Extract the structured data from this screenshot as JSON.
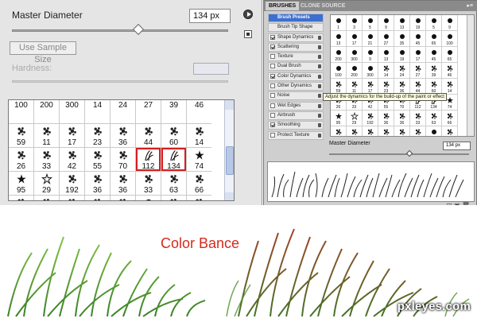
{
  "left_panel": {
    "master_diameter_label": "Master Diameter",
    "diameter_value": "134 px",
    "diameter_slider_value": 0.6,
    "use_sample_size_label": "Use Sample Size",
    "hardness_label": "Hardness:",
    "brush_grid": [
      {
        "n": "100",
        "icon": "none"
      },
      {
        "n": "200",
        "icon": "none"
      },
      {
        "n": "300",
        "icon": "none"
      },
      {
        "n": "14",
        "icon": "none"
      },
      {
        "n": "24",
        "icon": "none"
      },
      {
        "n": "27",
        "icon": "none"
      },
      {
        "n": "39",
        "icon": "none"
      },
      {
        "n": "46",
        "icon": "none"
      },
      {
        "n": "59",
        "icon": "spatter"
      },
      {
        "n": "11",
        "icon": "spatter"
      },
      {
        "n": "17",
        "icon": "spatter"
      },
      {
        "n": "23",
        "icon": "spatter"
      },
      {
        "n": "36",
        "icon": "spatter"
      },
      {
        "n": "44",
        "icon": "spatter"
      },
      {
        "n": "60",
        "icon": "spatter"
      },
      {
        "n": "14",
        "icon": "spatter"
      },
      {
        "n": "26",
        "icon": "spatter"
      },
      {
        "n": "33",
        "icon": "spatter"
      },
      {
        "n": "42",
        "icon": "spatter"
      },
      {
        "n": "55",
        "icon": "spatter"
      },
      {
        "n": "70",
        "icon": "spatter"
      },
      {
        "n": "112",
        "icon": "grass"
      },
      {
        "n": "134",
        "icon": "grass"
      },
      {
        "n": "74",
        "icon": "leaf"
      },
      {
        "n": "95",
        "icon": "leaf"
      },
      {
        "n": "29",
        "icon": "star"
      },
      {
        "n": "192",
        "icon": "spatter"
      },
      {
        "n": "36",
        "icon": "spatter"
      },
      {
        "n": "36",
        "icon": "spatter"
      },
      {
        "n": "33",
        "icon": "spatter"
      },
      {
        "n": "63",
        "icon": "spatter"
      },
      {
        "n": "66",
        "icon": "spatter"
      },
      {
        "n": "",
        "icon": "spatter"
      },
      {
        "n": "",
        "icon": "spatter"
      },
      {
        "n": "",
        "icon": "spatter"
      },
      {
        "n": "",
        "icon": "spatter"
      },
      {
        "n": "",
        "icon": "spatter"
      },
      {
        "n": "",
        "icon": "dot"
      },
      {
        "n": "",
        "icon": "spatter"
      },
      {
        "n": "",
        "icon": "spatter"
      }
    ],
    "selected_index": 22
  },
  "right_panel": {
    "tab_brushes": "BRUSHES",
    "tab_clone_source": "CLONE SOURCE",
    "menu": [
      {
        "label": "Brush Presets",
        "check": null,
        "lock": false,
        "preset": true
      },
      {
        "label": "Brush Tip Shape",
        "check": null,
        "lock": false,
        "preset": false
      },
      {
        "label": "Shape Dynamics",
        "check": true,
        "lock": true,
        "preset": false
      },
      {
        "label": "Scattering",
        "check": true,
        "lock": true,
        "preset": false
      },
      {
        "label": "Texture",
        "check": false,
        "lock": true,
        "preset": false
      },
      {
        "label": "Dual Brush",
        "check": false,
        "lock": true,
        "preset": false
      },
      {
        "label": "Color Dynamics",
        "check": true,
        "lock": true,
        "preset": false
      },
      {
        "label": "Other Dynamics",
        "check": false,
        "lock": true,
        "preset": false
      },
      {
        "label": "Noise",
        "check": false,
        "lock": true,
        "preset": false
      },
      {
        "label": "Wet Edges",
        "check": false,
        "lock": true,
        "preset": false
      },
      {
        "label": "Airbrush",
        "check": false,
        "lock": true,
        "preset": false
      },
      {
        "label": "Smoothing",
        "check": true,
        "lock": true,
        "preset": false
      },
      {
        "label": "Protect Texture",
        "check": false,
        "lock": true,
        "preset": false
      }
    ],
    "tooltip": "Adjust the dynamics for the build-up of the paint or effect",
    "rgrid": [
      {
        "n": "1",
        "icon": "dot"
      },
      {
        "n": "3",
        "icon": "dot"
      },
      {
        "n": "5",
        "icon": "dot"
      },
      {
        "n": "9",
        "icon": "dot"
      },
      {
        "n": "13",
        "icon": "dot"
      },
      {
        "n": "19",
        "icon": "dot"
      },
      {
        "n": "5",
        "icon": "dot"
      },
      {
        "n": "9",
        "icon": "dot"
      },
      {
        "n": "13",
        "icon": "dot"
      },
      {
        "n": "17",
        "icon": "dot"
      },
      {
        "n": "21",
        "icon": "dot"
      },
      {
        "n": "27",
        "icon": "dot"
      },
      {
        "n": "35",
        "icon": "dot"
      },
      {
        "n": "45",
        "icon": "dot"
      },
      {
        "n": "65",
        "icon": "dot"
      },
      {
        "n": "100",
        "icon": "dot"
      },
      {
        "n": "200",
        "icon": "dot"
      },
      {
        "n": "300",
        "icon": "dot"
      },
      {
        "n": "9",
        "icon": "dot"
      },
      {
        "n": "13",
        "icon": "dot"
      },
      {
        "n": "19",
        "icon": "dot"
      },
      {
        "n": "17",
        "icon": "dot"
      },
      {
        "n": "45",
        "icon": "dot"
      },
      {
        "n": "65",
        "icon": "dot"
      },
      {
        "n": "100",
        "icon": "dot"
      },
      {
        "n": "200",
        "icon": "dot"
      },
      {
        "n": "300",
        "icon": "dot"
      },
      {
        "n": "14",
        "icon": "spatter"
      },
      {
        "n": "24",
        "icon": "spatter"
      },
      {
        "n": "27",
        "icon": "spatter"
      },
      {
        "n": "39",
        "icon": "spatter"
      },
      {
        "n": "46",
        "icon": "spatter"
      },
      {
        "n": "59",
        "icon": "spatter"
      },
      {
        "n": "11",
        "icon": "spatter"
      },
      {
        "n": "17",
        "icon": "spatter"
      },
      {
        "n": "23",
        "icon": "spatter"
      },
      {
        "n": "36",
        "icon": "spatter"
      },
      {
        "n": "44",
        "icon": "spatter"
      },
      {
        "n": "60",
        "icon": "spatter"
      },
      {
        "n": "14",
        "icon": "spatter"
      },
      {
        "n": "26",
        "icon": "spatter"
      },
      {
        "n": "33",
        "icon": "spatter"
      },
      {
        "n": "42",
        "icon": "spatter"
      },
      {
        "n": "55",
        "icon": "spatter"
      },
      {
        "n": "70",
        "icon": "spatter"
      },
      {
        "n": "112",
        "icon": "grass"
      },
      {
        "n": "134",
        "icon": "grass"
      },
      {
        "n": "74",
        "icon": "leaf"
      },
      {
        "n": "95",
        "icon": "leaf"
      },
      {
        "n": "29",
        "icon": "star"
      },
      {
        "n": "192",
        "icon": "spatter"
      },
      {
        "n": "36",
        "icon": "spatter"
      },
      {
        "n": "36",
        "icon": "spatter"
      },
      {
        "n": "33",
        "icon": "spatter"
      },
      {
        "n": "63",
        "icon": "spatter"
      },
      {
        "n": "66",
        "icon": "spatter"
      },
      {
        "n": "39",
        "icon": "spatter"
      },
      {
        "n": "63",
        "icon": "spatter"
      },
      {
        "n": "11",
        "icon": "spatter"
      },
      {
        "n": "48",
        "icon": "spatter"
      },
      {
        "n": "32",
        "icon": "spatter"
      },
      {
        "n": "55",
        "icon": "spatter"
      },
      {
        "n": "100",
        "icon": "dot"
      },
      {
        "n": "75",
        "icon": "spatter"
      }
    ],
    "master_diameter_label": "Master Diameter",
    "diameter_value": "134 px"
  },
  "caption": "Color Bance",
  "watermark": "pxleyes.com",
  "colors": {
    "accent_red": "#d62a1d",
    "preset_blue": "#3d6fd1"
  }
}
